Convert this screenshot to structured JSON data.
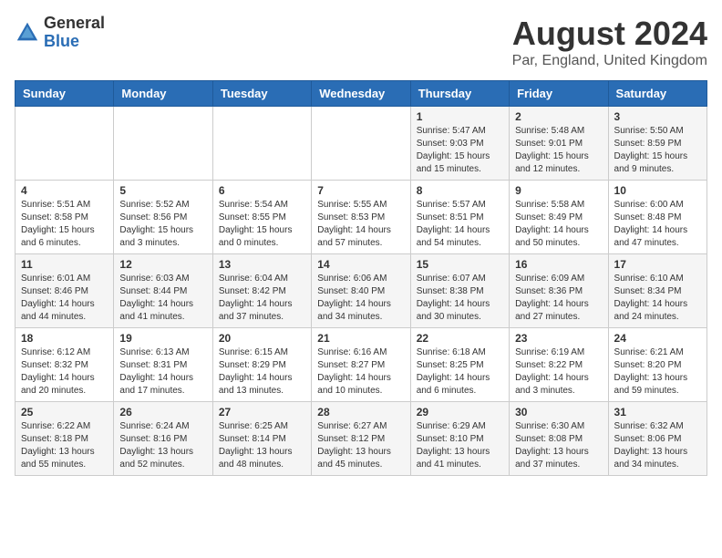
{
  "logo": {
    "general": "General",
    "blue": "Blue"
  },
  "title": {
    "month_year": "August 2024",
    "location": "Par, England, United Kingdom"
  },
  "weekdays": [
    "Sunday",
    "Monday",
    "Tuesday",
    "Wednesday",
    "Thursday",
    "Friday",
    "Saturday"
  ],
  "weeks": [
    [
      {
        "day": "",
        "info": ""
      },
      {
        "day": "",
        "info": ""
      },
      {
        "day": "",
        "info": ""
      },
      {
        "day": "",
        "info": ""
      },
      {
        "day": "1",
        "info": "Sunrise: 5:47 AM\nSunset: 9:03 PM\nDaylight: 15 hours and 15 minutes."
      },
      {
        "day": "2",
        "info": "Sunrise: 5:48 AM\nSunset: 9:01 PM\nDaylight: 15 hours and 12 minutes."
      },
      {
        "day": "3",
        "info": "Sunrise: 5:50 AM\nSunset: 8:59 PM\nDaylight: 15 hours and 9 minutes."
      }
    ],
    [
      {
        "day": "4",
        "info": "Sunrise: 5:51 AM\nSunset: 8:58 PM\nDaylight: 15 hours and 6 minutes."
      },
      {
        "day": "5",
        "info": "Sunrise: 5:52 AM\nSunset: 8:56 PM\nDaylight: 15 hours and 3 minutes."
      },
      {
        "day": "6",
        "info": "Sunrise: 5:54 AM\nSunset: 8:55 PM\nDaylight: 15 hours and 0 minutes."
      },
      {
        "day": "7",
        "info": "Sunrise: 5:55 AM\nSunset: 8:53 PM\nDaylight: 14 hours and 57 minutes."
      },
      {
        "day": "8",
        "info": "Sunrise: 5:57 AM\nSunset: 8:51 PM\nDaylight: 14 hours and 54 minutes."
      },
      {
        "day": "9",
        "info": "Sunrise: 5:58 AM\nSunset: 8:49 PM\nDaylight: 14 hours and 50 minutes."
      },
      {
        "day": "10",
        "info": "Sunrise: 6:00 AM\nSunset: 8:48 PM\nDaylight: 14 hours and 47 minutes."
      }
    ],
    [
      {
        "day": "11",
        "info": "Sunrise: 6:01 AM\nSunset: 8:46 PM\nDaylight: 14 hours and 44 minutes."
      },
      {
        "day": "12",
        "info": "Sunrise: 6:03 AM\nSunset: 8:44 PM\nDaylight: 14 hours and 41 minutes."
      },
      {
        "day": "13",
        "info": "Sunrise: 6:04 AM\nSunset: 8:42 PM\nDaylight: 14 hours and 37 minutes."
      },
      {
        "day": "14",
        "info": "Sunrise: 6:06 AM\nSunset: 8:40 PM\nDaylight: 14 hours and 34 minutes."
      },
      {
        "day": "15",
        "info": "Sunrise: 6:07 AM\nSunset: 8:38 PM\nDaylight: 14 hours and 30 minutes."
      },
      {
        "day": "16",
        "info": "Sunrise: 6:09 AM\nSunset: 8:36 PM\nDaylight: 14 hours and 27 minutes."
      },
      {
        "day": "17",
        "info": "Sunrise: 6:10 AM\nSunset: 8:34 PM\nDaylight: 14 hours and 24 minutes."
      }
    ],
    [
      {
        "day": "18",
        "info": "Sunrise: 6:12 AM\nSunset: 8:32 PM\nDaylight: 14 hours and 20 minutes."
      },
      {
        "day": "19",
        "info": "Sunrise: 6:13 AM\nSunset: 8:31 PM\nDaylight: 14 hours and 17 minutes."
      },
      {
        "day": "20",
        "info": "Sunrise: 6:15 AM\nSunset: 8:29 PM\nDaylight: 14 hours and 13 minutes."
      },
      {
        "day": "21",
        "info": "Sunrise: 6:16 AM\nSunset: 8:27 PM\nDaylight: 14 hours and 10 minutes."
      },
      {
        "day": "22",
        "info": "Sunrise: 6:18 AM\nSunset: 8:25 PM\nDaylight: 14 hours and 6 minutes."
      },
      {
        "day": "23",
        "info": "Sunrise: 6:19 AM\nSunset: 8:22 PM\nDaylight: 14 hours and 3 minutes."
      },
      {
        "day": "24",
        "info": "Sunrise: 6:21 AM\nSunset: 8:20 PM\nDaylight: 13 hours and 59 minutes."
      }
    ],
    [
      {
        "day": "25",
        "info": "Sunrise: 6:22 AM\nSunset: 8:18 PM\nDaylight: 13 hours and 55 minutes."
      },
      {
        "day": "26",
        "info": "Sunrise: 6:24 AM\nSunset: 8:16 PM\nDaylight: 13 hours and 52 minutes."
      },
      {
        "day": "27",
        "info": "Sunrise: 6:25 AM\nSunset: 8:14 PM\nDaylight: 13 hours and 48 minutes."
      },
      {
        "day": "28",
        "info": "Sunrise: 6:27 AM\nSunset: 8:12 PM\nDaylight: 13 hours and 45 minutes."
      },
      {
        "day": "29",
        "info": "Sunrise: 6:29 AM\nSunset: 8:10 PM\nDaylight: 13 hours and 41 minutes."
      },
      {
        "day": "30",
        "info": "Sunrise: 6:30 AM\nSunset: 8:08 PM\nDaylight: 13 hours and 37 minutes."
      },
      {
        "day": "31",
        "info": "Sunrise: 6:32 AM\nSunset: 8:06 PM\nDaylight: 13 hours and 34 minutes."
      }
    ]
  ]
}
